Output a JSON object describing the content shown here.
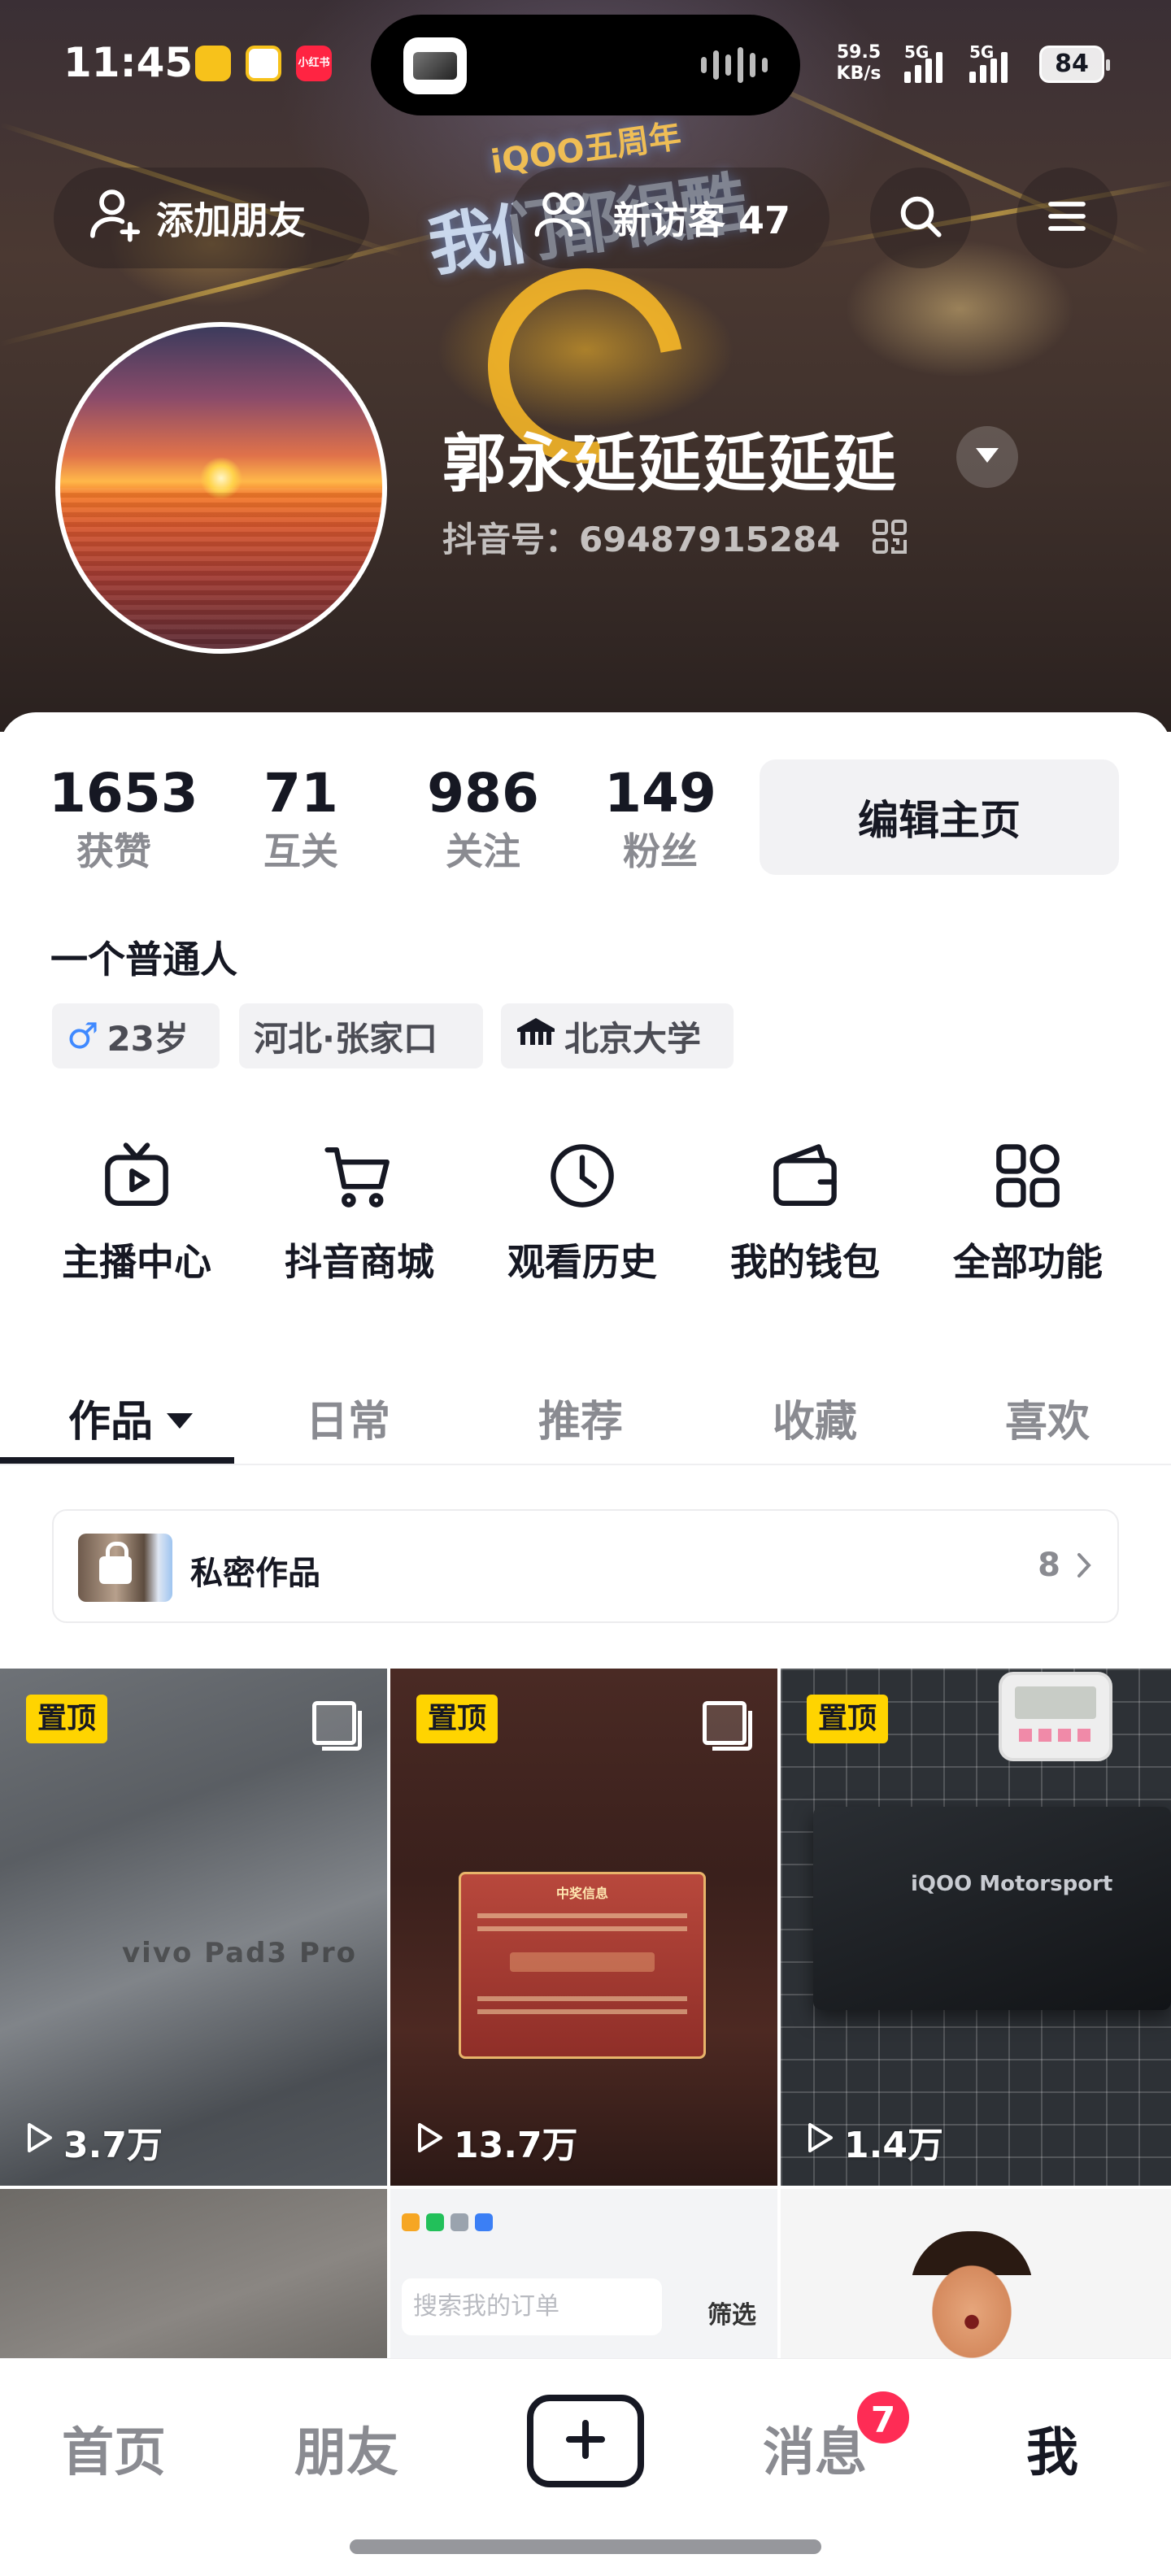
{
  "status_bar": {
    "time": "11:45",
    "net_speed_value": "59.5",
    "net_speed_unit": "KB/s",
    "signal1_label": "5G",
    "signal2_label": "5G",
    "battery": "84",
    "app_icons": [
      "meituan-icon",
      "weibo-icon",
      "xiaohongshu-icon"
    ],
    "xiaohongshu_label": "小红书"
  },
  "header": {
    "add_friend_label": "添加朋友",
    "visitors_label": "新访客 47",
    "event_banner_line1": "iQOO五周年",
    "event_banner_line2": "我们都很酷"
  },
  "profile": {
    "nickname": "郭永延延延延延",
    "douyin_id": "抖音号：69487915284"
  },
  "stats": [
    {
      "value": "1653",
      "label": "获赞"
    },
    {
      "value": "71",
      "label": "互关"
    },
    {
      "value": "986",
      "label": "关注"
    },
    {
      "value": "149",
      "label": "粉丝"
    }
  ],
  "edit_profile_label": "编辑主页",
  "signature": "一个普通人",
  "tags": {
    "age": "23岁",
    "location": "河北·张家口",
    "school": "北京大学"
  },
  "functions": [
    {
      "label": "主播中心",
      "icon": "tv-icon"
    },
    {
      "label": "抖音商城",
      "icon": "cart-icon"
    },
    {
      "label": "观看历史",
      "icon": "clock-icon"
    },
    {
      "label": "我的钱包",
      "icon": "wallet-icon"
    },
    {
      "label": "全部功能",
      "icon": "grid-icon"
    }
  ],
  "tabs": [
    {
      "label": "作品",
      "active": true
    },
    {
      "label": "日常"
    },
    {
      "label": "推荐"
    },
    {
      "label": "收藏"
    },
    {
      "label": "喜欢"
    }
  ],
  "private_works": {
    "label": "私密作品",
    "count": "8"
  },
  "videos": [
    {
      "pinned_label": "置顶",
      "plays": "3.7万",
      "overlay_text": "vivo Pad3 Pro"
    },
    {
      "pinned_label": "置顶",
      "plays": "13.7万",
      "overlay_text": "中奖信息"
    },
    {
      "pinned_label": "置顶",
      "plays": "1.4万",
      "overlay_text": "iQOO Motorsport"
    },
    {
      "overlay_text": ""
    },
    {
      "overlay_text": "搜索我的订单",
      "filter_label": "筛选"
    },
    {
      "overlay_text": ""
    }
  ],
  "bottom_nav": {
    "home": "首页",
    "friends": "朋友",
    "messages": "消息",
    "messages_badge": "7",
    "me": "我"
  },
  "colors": {
    "accent_red": "#fe2c55",
    "pin_yellow": "#ffd400",
    "text_primary": "#161823",
    "text_secondary": "#8a8b91"
  }
}
